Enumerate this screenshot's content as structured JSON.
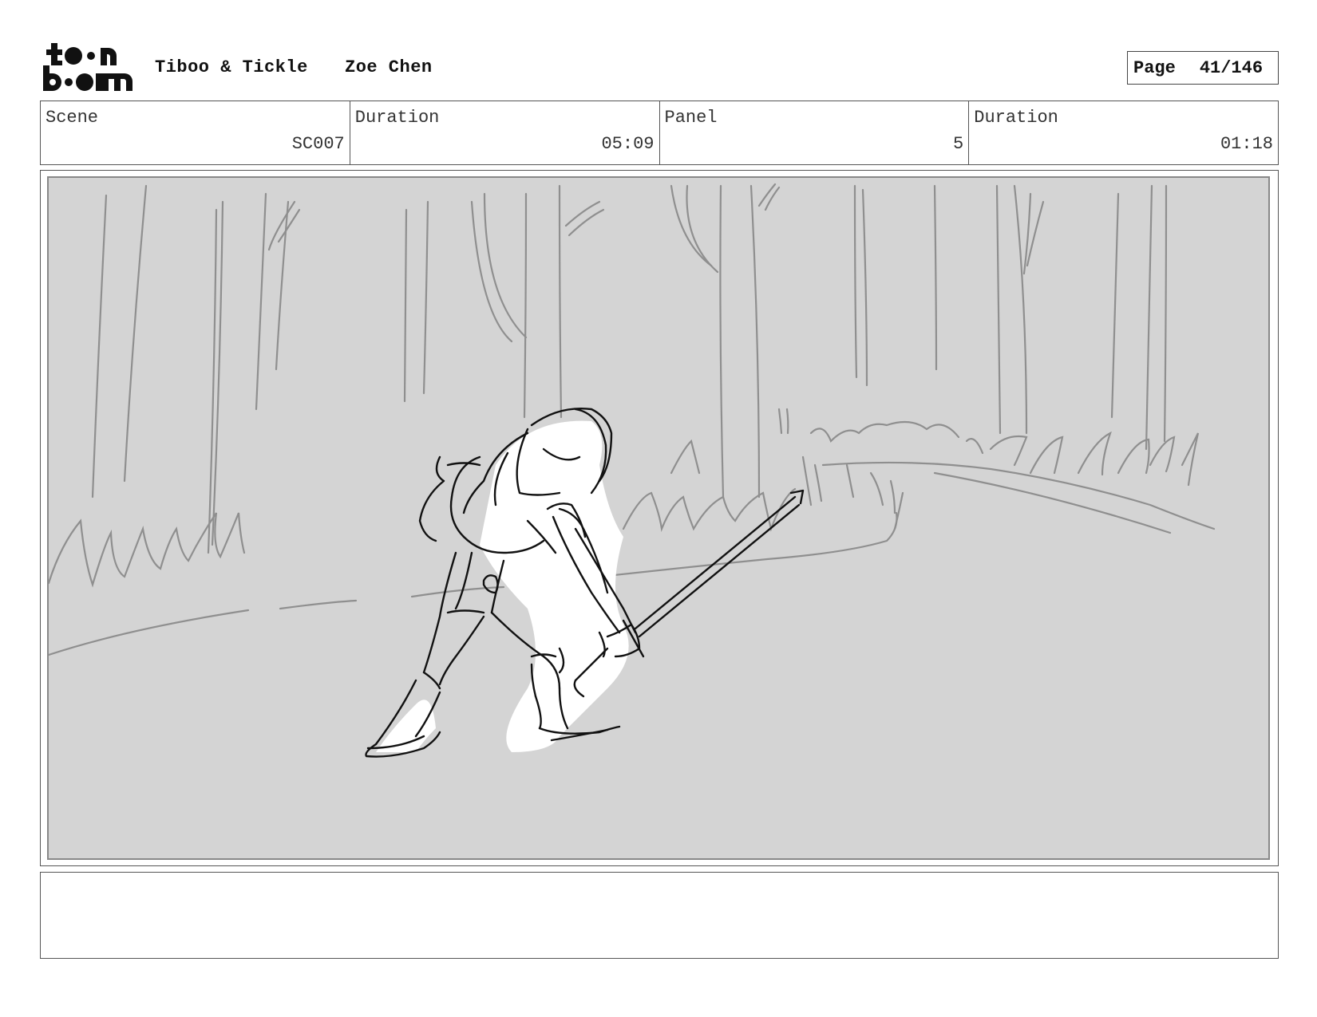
{
  "header": {
    "logo_text": "toon boom",
    "project_title": "Tiboo & Tickle",
    "author": "Zoe Chen",
    "page_label": "Page",
    "page_number": "41/146"
  },
  "info": {
    "scene_label": "Scene",
    "scene_value": "SC007",
    "scene_duration_label": "Duration",
    "scene_duration_value": "05:09",
    "panel_label": "Panel",
    "panel_value": "5",
    "panel_duration_label": "Duration",
    "panel_duration_value": "01:18"
  },
  "panel": {
    "background": "#d4d4d4",
    "sketch_color": "#111111",
    "background_sketch_color": "#8a8a8a"
  },
  "caption": {
    "text": ""
  }
}
